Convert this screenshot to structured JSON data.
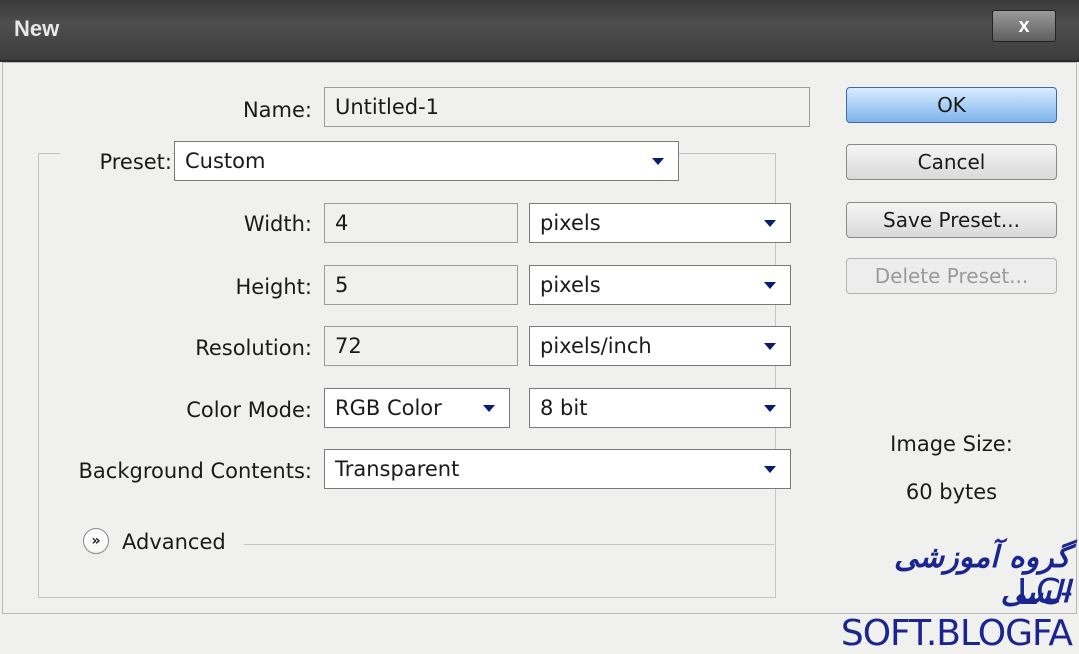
{
  "window": {
    "title": "New",
    "close_label": "x"
  },
  "form": {
    "name_label": "Name:",
    "name_value": "Untitled-1",
    "preset_label": "Preset:",
    "preset_value": "Custom",
    "width_label": "Width:",
    "width_value": "4",
    "width_unit": "pixels",
    "height_label": "Height:",
    "height_value": "5",
    "height_unit": "pixels",
    "resolution_label": "Resolution:",
    "resolution_value": "72",
    "resolution_unit": "pixels/inch",
    "color_mode_label": "Color Mode:",
    "color_mode_value": "RGB Color",
    "bit_depth_value": "8 bit",
    "background_label": "Background Contents:",
    "background_value": "Transparent",
    "advanced_label": "Advanced"
  },
  "buttons": {
    "ok": "OK",
    "cancel": "Cancel",
    "save_preset": "Save Preset...",
    "delete_preset": "Delete Preset..."
  },
  "image_size": {
    "label": "Image Size:",
    "value": "60 bytes"
  },
  "watermark": {
    "persian": "گروه آموزشی السی",
    "english": "LC-SOFT.BLOGFA"
  },
  "colors": {
    "accent": "#7fb4ec",
    "titlebar": "#444444",
    "watermark": "#1a2590",
    "dropdown_arrow": "#0a1a70"
  }
}
